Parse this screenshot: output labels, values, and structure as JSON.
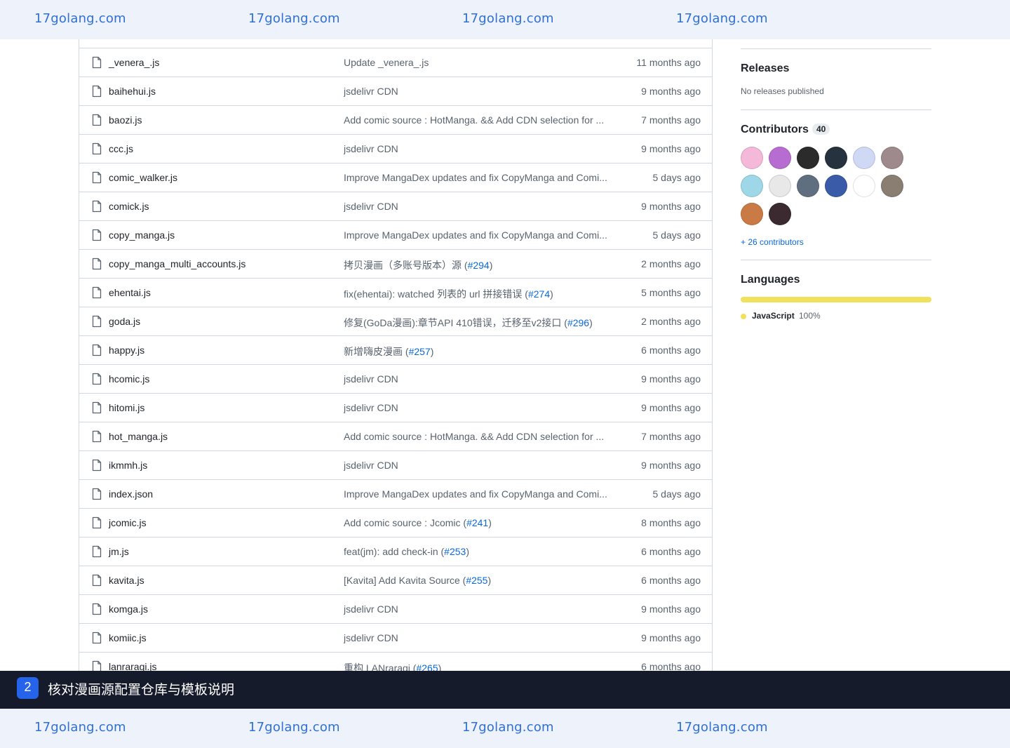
{
  "watermark": {
    "text": "17golang.com"
  },
  "files": [
    {
      "name": "_venera_.js",
      "message": "Update _venera_.js",
      "issue": "",
      "time": "11 months ago"
    },
    {
      "name": "baihehui.js",
      "message": "jsdelivr CDN",
      "issue": "",
      "time": "9 months ago"
    },
    {
      "name": "baozi.js",
      "message": "Add comic source : HotManga. && Add CDN selection for ...",
      "issue": "",
      "time": "7 months ago"
    },
    {
      "name": "ccc.js",
      "message": "jsdelivr CDN",
      "issue": "",
      "time": "9 months ago"
    },
    {
      "name": "comic_walker.js",
      "message": "Improve MangaDex updates and fix CopyManga and Comi...",
      "issue": "",
      "time": "5 days ago"
    },
    {
      "name": "comick.js",
      "message": "jsdelivr CDN",
      "issue": "",
      "time": "9 months ago"
    },
    {
      "name": "copy_manga.js",
      "message": "Improve MangaDex updates and fix CopyManga and Comi...",
      "issue": "",
      "time": "5 days ago"
    },
    {
      "name": "copy_manga_multi_accounts.js",
      "message": "拷贝漫画（多账号版本）源 (",
      "issue": "#294",
      "time": "2 months ago"
    },
    {
      "name": "ehentai.js",
      "message": "fix(ehentai): watched 列表的 url 拼接错误 (",
      "issue": "#274",
      "time": "5 months ago"
    },
    {
      "name": "goda.js",
      "message": "修复(GoDa漫画):章节API 410错误，迁移至v2接口 (",
      "issue": "#296",
      "time": "2 months ago"
    },
    {
      "name": "happy.js",
      "message": "新增嗨皮漫画 (",
      "issue": "#257",
      "time": "6 months ago"
    },
    {
      "name": "hcomic.js",
      "message": "jsdelivr CDN",
      "issue": "",
      "time": "9 months ago"
    },
    {
      "name": "hitomi.js",
      "message": "jsdelivr CDN",
      "issue": "",
      "time": "9 months ago"
    },
    {
      "name": "hot_manga.js",
      "message": "Add comic source : HotManga. && Add CDN selection for ...",
      "issue": "",
      "time": "7 months ago"
    },
    {
      "name": "ikmmh.js",
      "message": "jsdelivr CDN",
      "issue": "",
      "time": "9 months ago"
    },
    {
      "name": "index.json",
      "message": "Improve MangaDex updates and fix CopyManga and Comi...",
      "issue": "",
      "time": "5 days ago"
    },
    {
      "name": "jcomic.js",
      "message": "Add comic source : Jcomic (",
      "issue": "#241",
      "time": "8 months ago"
    },
    {
      "name": "jm.js",
      "message": "feat(jm): add check-in (",
      "issue": "#253",
      "time": "6 months ago"
    },
    {
      "name": "kavita.js",
      "message": "[Kavita] Add Kavita Source (",
      "issue": "#255",
      "time": "6 months ago"
    },
    {
      "name": "komga.js",
      "message": "jsdelivr CDN",
      "issue": "",
      "time": "9 months ago"
    },
    {
      "name": "komiic.js",
      "message": "jsdelivr CDN",
      "issue": "",
      "time": "9 months ago"
    },
    {
      "name": "lanraragi.js",
      "message": "重构 LANraragi (",
      "issue": "#265",
      "time": "6 months ago"
    }
  ],
  "sidebar": {
    "releases": {
      "title": "Releases",
      "empty_text": "No releases published"
    },
    "contributors": {
      "title": "Contributors",
      "count": "40",
      "more_link": "+ 26 contributors",
      "avatar_colors": [
        "#f4b9d8",
        "#b76cd1",
        "#2b2b2b",
        "#27323f",
        "#cfd8f5",
        "#9e8a8c",
        "#9ed7e8",
        "#e8e8e8",
        "#5f6f80",
        "#3a5ba8",
        "#ffffff",
        "#8a7d72",
        "#c97a45",
        "#3b2a2f"
      ]
    },
    "languages": {
      "title": "Languages",
      "name": "JavaScript",
      "percent": "100%",
      "color": "#f1e05a"
    }
  },
  "caption": {
    "step": "2",
    "text": "核对漫画源配置仓库与模板说明"
  }
}
